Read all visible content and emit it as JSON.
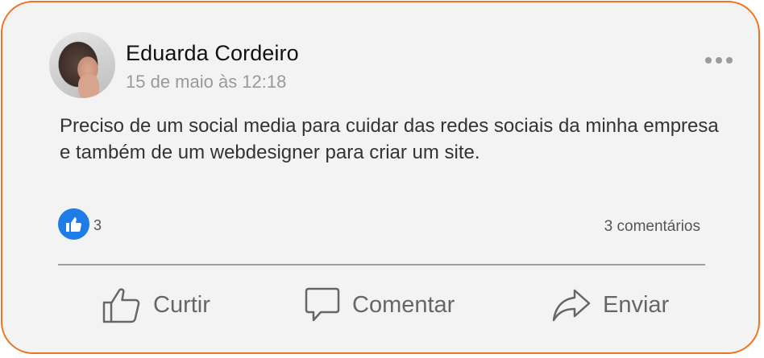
{
  "post": {
    "author": "Eduarda Cordeiro",
    "timestamp": "15 de maio às 12:18",
    "text": "Preciso de um social media para cuidar das redes sociais da minha empresa e também de um webdesigner para criar um site.",
    "like_count": "3",
    "comments_count": "3 comentários"
  },
  "actions": {
    "like_label": "Curtir",
    "comment_label": "Comentar",
    "share_label": "Enviar"
  },
  "icons": {
    "more": "more-horizontal-icon",
    "like_badge": "thumbs-up-icon",
    "like": "thumbs-up-outline-icon",
    "comment": "speech-bubble-icon",
    "share": "share-arrow-icon"
  },
  "colors": {
    "border": "#f0731e",
    "card_bg": "#f3f3f3",
    "like_badge": "#1e7be8",
    "text": "#333333",
    "muted": "#9a9a9a"
  }
}
